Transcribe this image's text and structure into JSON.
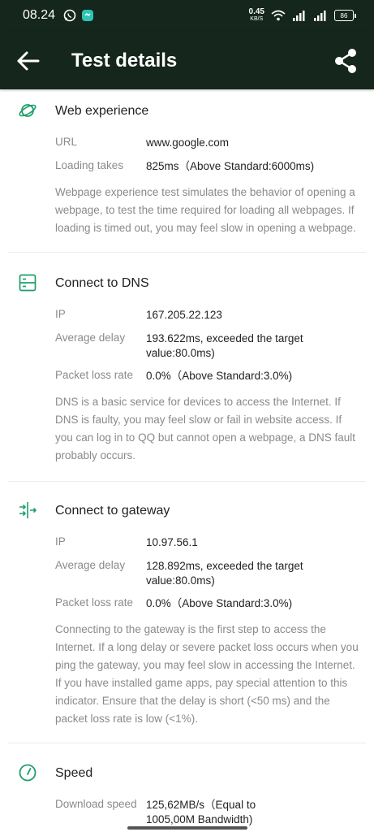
{
  "status_bar": {
    "time": "08.24",
    "net_speed_value": "0.45",
    "net_speed_unit": "KB/S",
    "battery": "86"
  },
  "app_bar": {
    "title": "Test details"
  },
  "colors": {
    "header_bg": "#15261c",
    "accent": "#1e9e6a"
  },
  "sections": [
    {
      "icon": "planet-icon",
      "title": "Web experience",
      "rows": [
        {
          "label": "URL",
          "value": "www.google.com"
        },
        {
          "label": "Loading takes",
          "value": "825ms（Above Standard:6000ms)"
        }
      ],
      "description": "Webpage experience test simulates the behavior of opening a webpage, to test the time required for loading all webpages. If loading is timed out, you may feel slow in opening a webpage."
    },
    {
      "icon": "server-icon",
      "title": "Connect to DNS",
      "rows": [
        {
          "label": "IP",
          "value": "167.205.22.123"
        },
        {
          "label": "Average delay",
          "value": "193.622ms, exceeded the target value:80.0ms)"
        },
        {
          "label": "Packet loss rate",
          "value": "0.0%（Above Standard:3.0%)"
        }
      ],
      "description": "DNS is a basic service for devices to access the Internet. If DNS is faulty, you may feel slow or fail in website access. If you can log in to QQ but cannot open a webpage, a DNS fault probably occurs."
    },
    {
      "icon": "gateway-arrows-icon",
      "title": "Connect to gateway",
      "rows": [
        {
          "label": "IP",
          "value": "10.97.56.1"
        },
        {
          "label": "Average delay",
          "value": "128.892ms, exceeded the target value:80.0ms)"
        },
        {
          "label": "Packet loss rate",
          "value": "0.0%（Above Standard:3.0%)"
        }
      ],
      "description": "Connecting to the gateway is the first step to access the Internet. If a long delay or severe packet loss occurs when you ping the gateway, you may feel slow in accessing the Internet. If you have installed game apps, pay special attention to this indicator. Ensure that the delay is short (<50 ms) and the packet loss rate is low (<1%)."
    },
    {
      "icon": "speedometer-icon",
      "title": "Speed",
      "rows": [
        {
          "label": "Download speed",
          "value": "125,62MB/s（Equal to 1005,00M Bandwidth)"
        }
      ],
      "description": ""
    }
  ]
}
